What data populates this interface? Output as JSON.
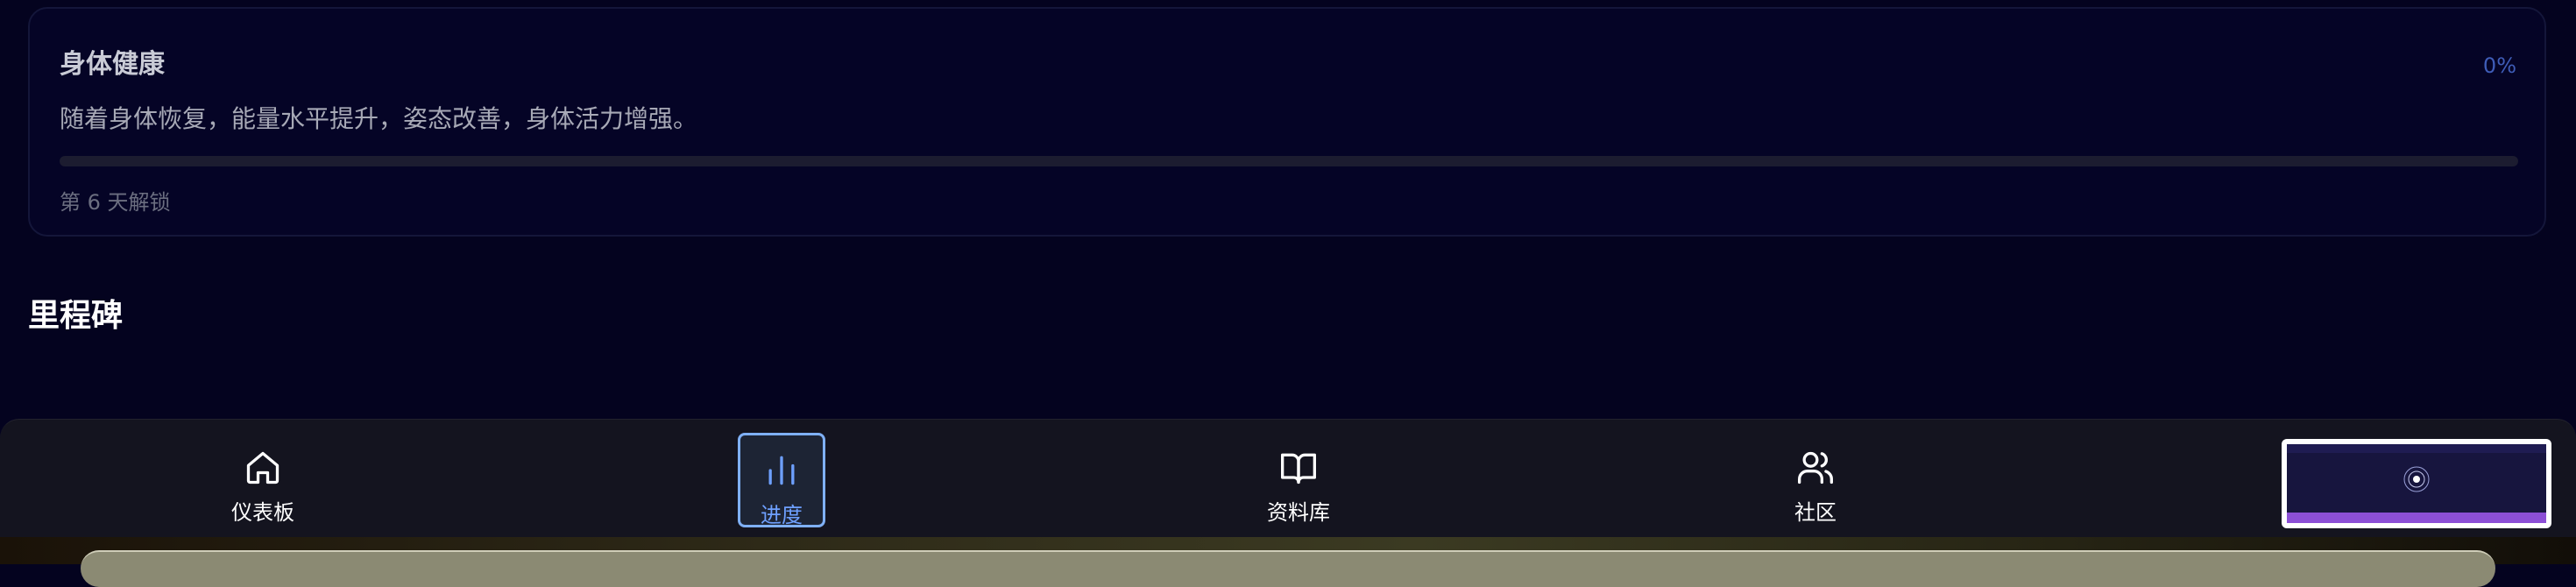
{
  "card": {
    "title": "身体健康",
    "percent_label": "0%",
    "progress": 0,
    "description": "随着身体恢复，能量水平提升，姿态改善，身体活力增强。",
    "unlock_text": "第 6 天解锁"
  },
  "milestones": {
    "title": "里程碑"
  },
  "nav": {
    "items": [
      {
        "label": "仪表板",
        "icon": "home-icon",
        "active": false
      },
      {
        "label": "进度",
        "icon": "bar-chart-icon",
        "active": true
      },
      {
        "label": "资料库",
        "icon": "book-icon",
        "active": false
      },
      {
        "label": "社区",
        "icon": "users-icon",
        "active": false
      }
    ]
  },
  "colors": {
    "background": "#04031f",
    "accent": "#6ea0ff",
    "nav_background": "#14141f"
  }
}
